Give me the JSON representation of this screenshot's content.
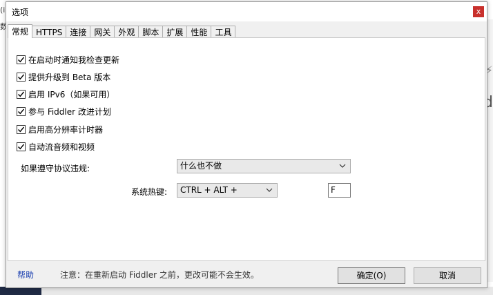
{
  "background": {
    "left_top_char": "(i",
    "left_char": "数",
    "right_glyph_1": "⚡",
    "right_glyph_2": "d"
  },
  "dialog": {
    "title": "选项",
    "close_glyph": "x"
  },
  "tabs": [
    {
      "label": "常规",
      "active": true
    },
    {
      "label": "HTTPS"
    },
    {
      "label": "连接"
    },
    {
      "label": "网关"
    },
    {
      "label": "外观"
    },
    {
      "label": "脚本"
    },
    {
      "label": "扩展"
    },
    {
      "label": "性能"
    },
    {
      "label": "工具"
    }
  ],
  "general": {
    "checkboxes": [
      {
        "label": "在启动时通知我检查更新",
        "checked": true
      },
      {
        "label": "提供升级到 Beta 版本",
        "checked": true
      },
      {
        "label": "启用 IPv6（如果可用）",
        "checked": true
      },
      {
        "label": "参与 Fiddler 改进计划",
        "checked": true
      },
      {
        "label": "启用高分辨率计时器",
        "checked": true
      },
      {
        "label": "自动流音频和视频",
        "checked": true
      }
    ],
    "protocol_violation_label": "如果遵守协议违规:",
    "protocol_violation_value": "什么也不做",
    "hotkey_label": "系统热键:",
    "hotkey_modifier": "CTRL + ALT +",
    "hotkey_key": "F"
  },
  "footer": {
    "help": "帮助",
    "note": "注意：在重新启动 Fiddler 之前，更改可能不会生效。",
    "ok": "确定(O)",
    "cancel": "取消"
  }
}
